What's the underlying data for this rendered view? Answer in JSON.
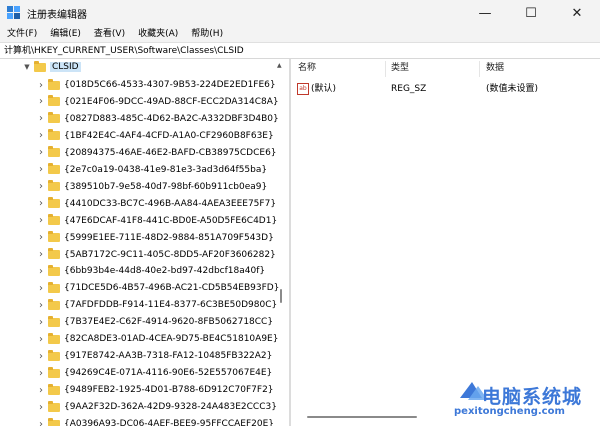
{
  "window": {
    "title": "注册表编辑器",
    "minimize_glyph": "—",
    "maximize_glyph": "☐",
    "close_glyph": "✕"
  },
  "menu": [
    "文件(F)",
    "编辑(E)",
    "查看(V)",
    "收藏夹(A)",
    "帮助(H)"
  ],
  "address": "计算机\\HKEY_CURRENT_USER\\Software\\Classes\\CLSID",
  "tree": {
    "selected": "CLSID",
    "children": [
      "{018D5C66-4533-4307-9B53-224DE2ED1FE6}",
      "{021E4F06-9DCC-49AD-88CF-ECC2DA314C8A}",
      "{0827D883-485C-4D62-BA2C-A332DBF3D4B0}",
      "{1BF42E4C-4AF4-4CFD-A1A0-CF2960B8F63E}",
      "{20894375-46AE-46E2-BAFD-CB38975CDCE6}",
      "{2e7c0a19-0438-41e9-81e3-3ad3d64f55ba}",
      "{389510b7-9e58-40d7-98bf-60b911cb0ea9}",
      "{4410DC33-BC7C-496B-AA84-4AEA3EEE75F7}",
      "{47E6DCAF-41F8-441C-BD0E-A50D5FE6C4D1}",
      "{5999E1EE-711E-48D2-9884-851A709F543D}",
      "{5AB7172C-9C11-405C-8DD5-AF20F3606282}",
      "{6bb93b4e-44d8-40e2-bd97-42dbcf18a40f}",
      "{71DCE5D6-4B57-496B-AC21-CD5B54EB93FD}",
      "{7AFDFDDB-F914-11E4-8377-6C3BE50D980C}",
      "{7B37E4E2-C62F-4914-9620-8FB5062718CC}",
      "{82CA8DE3-01AD-4CEA-9D75-BE4C51810A9E}",
      "{917E8742-AA3B-7318-FA12-10485FB322A2}",
      "{94269C4E-071A-4116-90E6-52E557067E4E}",
      "{9489FEB2-1925-4D01-B788-6D912C70F7F2}",
      "{9AA2F32D-362A-42D9-9328-24A483E2CCC3}",
      "{A0396A93-DC06-4AEF-BEE9-95FFCCAEF20E}"
    ]
  },
  "values": {
    "headers": {
      "name": "名称",
      "type": "类型",
      "data": "数据"
    },
    "rows": [
      {
        "name": "(默认)",
        "type": "REG_SZ",
        "data": "(数值未设置)"
      }
    ]
  },
  "watermark": {
    "title": "电脑系统城",
    "url": "pexitongcheng.com"
  },
  "colors": {
    "folder": "#f3c94a",
    "selection": "#cce4f7",
    "watermark": "#3d78d8"
  }
}
